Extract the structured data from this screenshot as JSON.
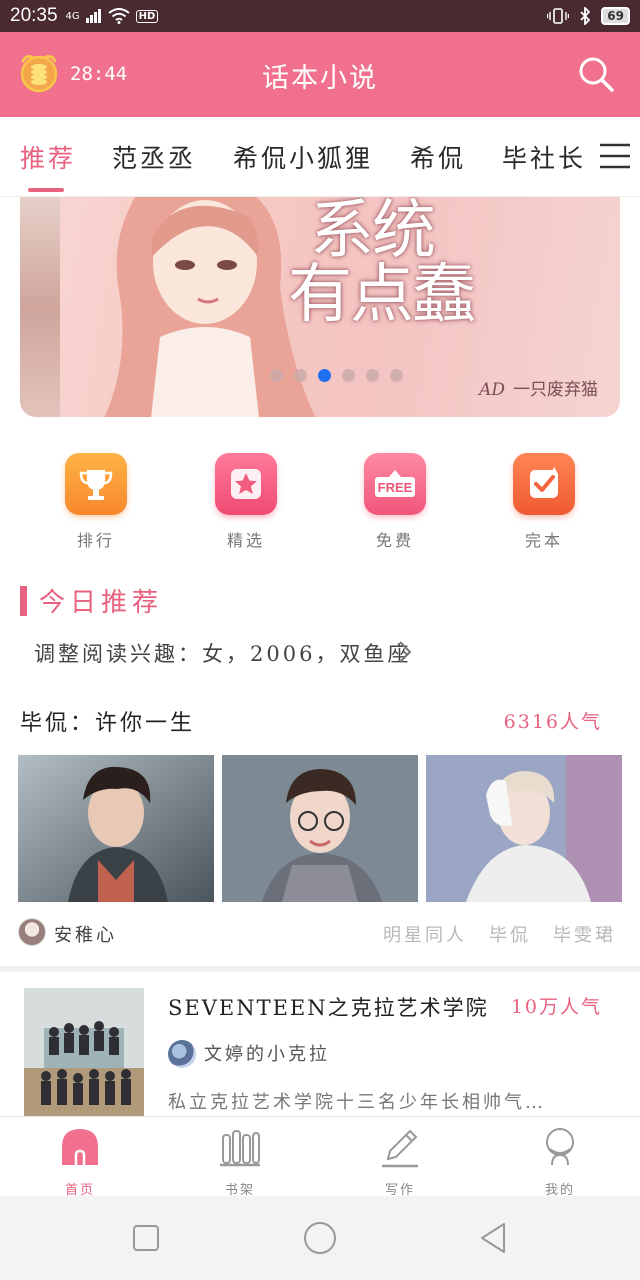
{
  "status_bar": {
    "time": "20:35",
    "network": "4G",
    "hd": "HD",
    "battery": "69"
  },
  "header": {
    "timer": "28:44",
    "title": "话本小说"
  },
  "tabs": {
    "items": [
      {
        "label": "推荐",
        "active": true
      },
      {
        "label": "范丞丞",
        "active": false
      },
      {
        "label": "希侃小狐狸",
        "active": false
      },
      {
        "label": "希侃",
        "active": false
      },
      {
        "label": "毕社长",
        "active": false
      }
    ]
  },
  "banner": {
    "title_line1": "系统",
    "title_line2": "有点蠢",
    "author": "一只废弃猫",
    "author_initials": "AD",
    "active_dot_index": 2,
    "dot_count": 6
  },
  "quick_links": [
    {
      "label": "排行",
      "icon": "trophy-icon",
      "color": "#f8922f"
    },
    {
      "label": "精选",
      "icon": "star-icon",
      "color": "#f2557a"
    },
    {
      "label": "免费",
      "icon": "free-tag-icon",
      "color": "#f25c7e"
    },
    {
      "label": "完本",
      "icon": "check-badge-icon",
      "color": "#f4643d"
    }
  ],
  "recommend": {
    "section_title": "今日推荐",
    "preference_text": "调整阅读兴趣：女，2006，双鱼座"
  },
  "featured_book": {
    "title": "毕侃：许你一生",
    "popularity": "6316人气",
    "author": "安稚心",
    "tags": [
      "明星同人",
      "毕侃",
      "毕雯珺"
    ]
  },
  "book_list": [
    {
      "title": "SEVENTEEN之克拉艺术学院",
      "popularity": "10万人气",
      "author": "文婷的小克拉",
      "description": "私立克拉艺术学院十三名少年长相帅气…"
    }
  ],
  "bottom_nav": [
    {
      "label": "首页",
      "icon": "home-icon",
      "active": true
    },
    {
      "label": "书架",
      "icon": "bookshelf-icon",
      "active": false
    },
    {
      "label": "写作",
      "icon": "pencil-icon",
      "active": false
    },
    {
      "label": "我的",
      "icon": "profile-icon",
      "active": false
    }
  ],
  "colors": {
    "brand": "#f0708e",
    "accent": "#e8627f",
    "status_bar": "#4a2a31"
  }
}
